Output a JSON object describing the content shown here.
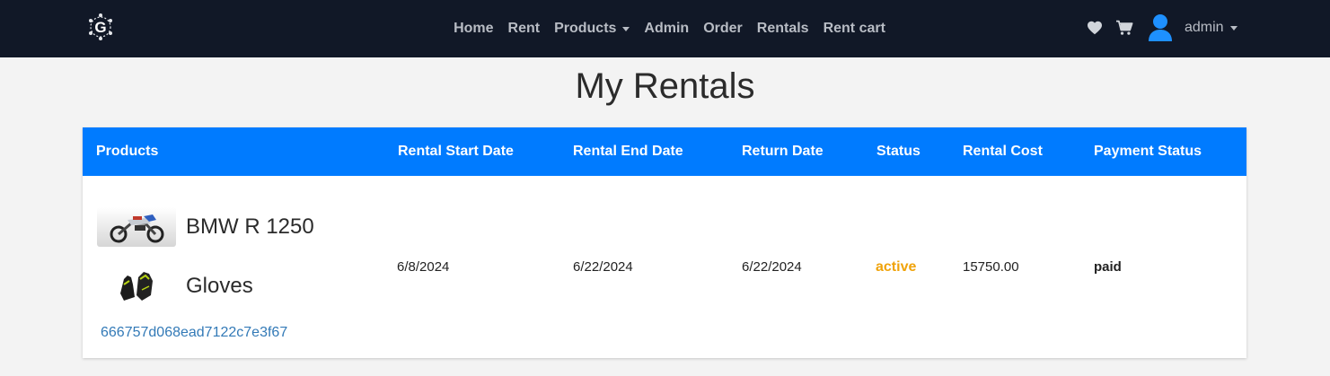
{
  "nav": {
    "links": [
      {
        "label": "Home"
      },
      {
        "label": "Rent"
      },
      {
        "label": "Products",
        "dropdown": true
      },
      {
        "label": "Admin"
      },
      {
        "label": "Order"
      },
      {
        "label": "Rentals"
      },
      {
        "label": "Rent cart"
      }
    ],
    "icons": [
      "logo-icon",
      "heart-icon",
      "cart-icon",
      "user-avatar-icon"
    ],
    "user": "admin"
  },
  "page": {
    "title": "My Rentals"
  },
  "table": {
    "headers": [
      "Products",
      "Rental Start Date",
      "Rental End Date",
      "Return Date",
      "Status",
      "Rental Cost",
      "Payment Status"
    ],
    "rows": [
      {
        "products": [
          {
            "name": "BMW R 1250",
            "image": "motorcycle-image"
          },
          {
            "name": "Gloves",
            "image": "gloves-image"
          }
        ],
        "order_id": "666757d068ead7122c7e3f67",
        "start_date": "6/8/2024",
        "end_date": "6/22/2024",
        "return_date": "6/22/2024",
        "status": "active",
        "cost": "15750.00",
        "payment_status": "paid"
      }
    ]
  },
  "colors": {
    "navbar": "#111827",
    "header": "#007bff",
    "status_active": "#f0a30a",
    "link": "#337ab7",
    "background": "#f3f3f3"
  }
}
